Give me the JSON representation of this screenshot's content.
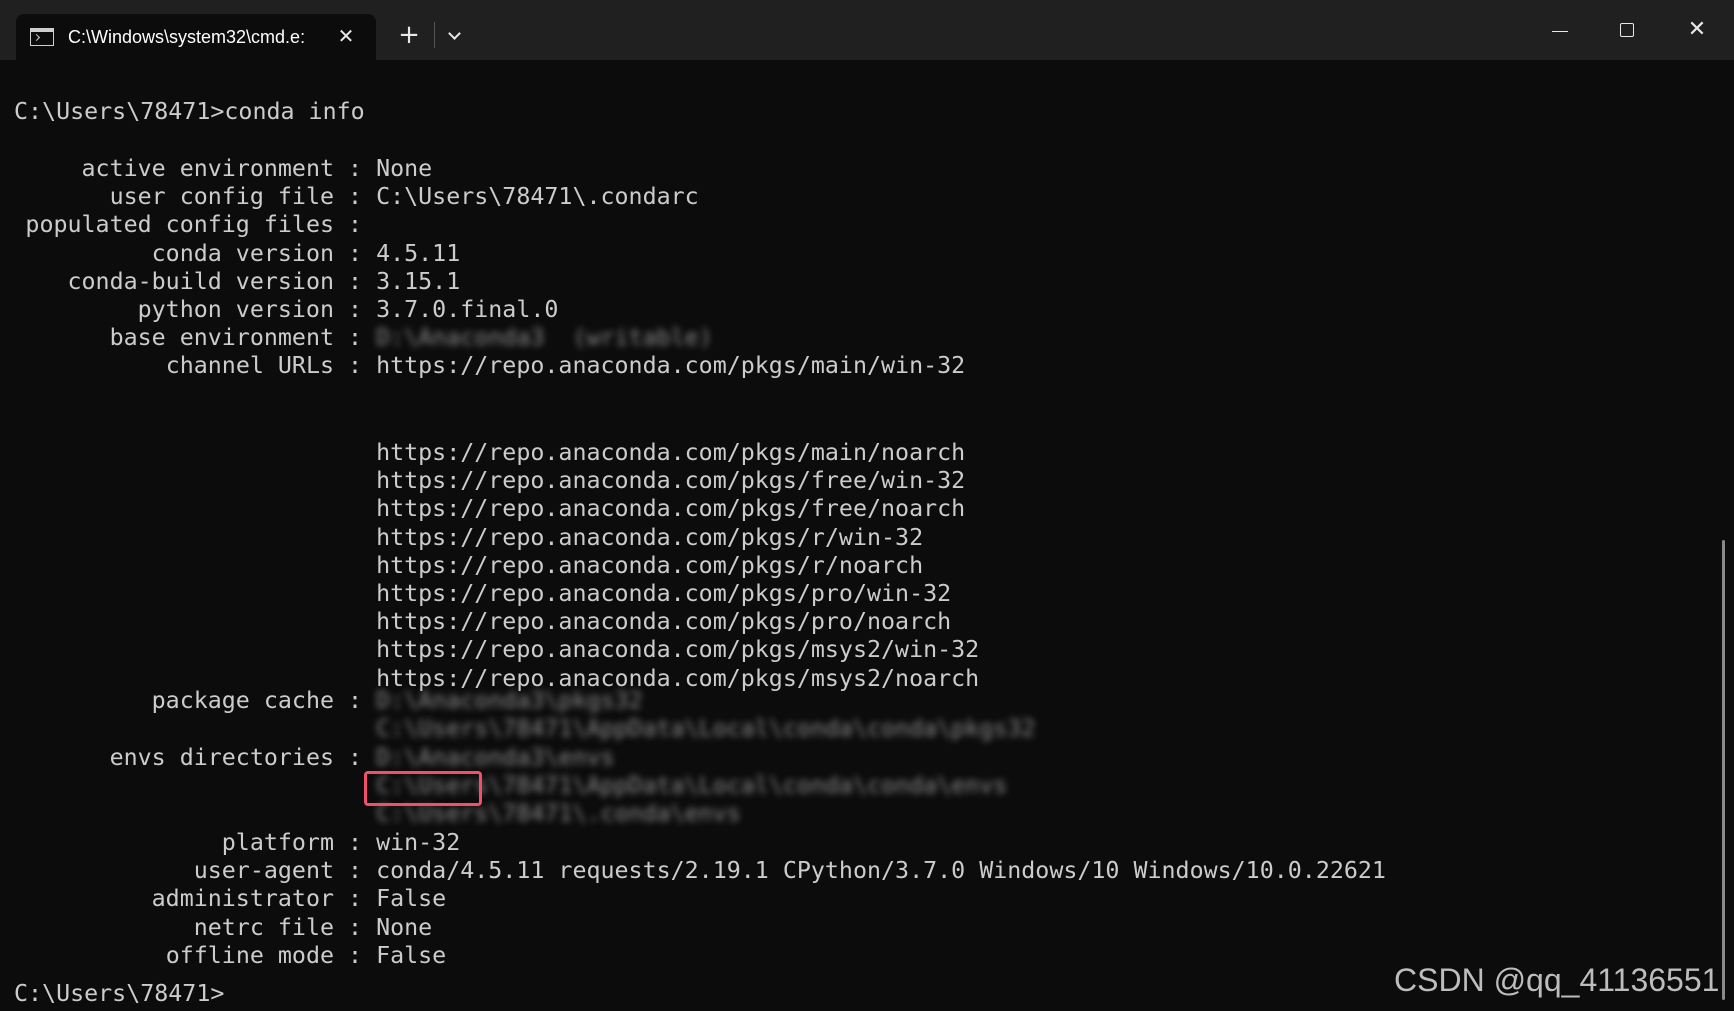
{
  "window": {
    "tab_title": "C:\\Windows\\system32\\cmd.e:",
    "tab_close": "✕",
    "new_tab": "+",
    "close_glyph": "✕"
  },
  "icons": {
    "tab": "terminal-icon",
    "close_tab": "close-icon",
    "new_tab": "plus-icon",
    "dropdown": "chevron-down-icon",
    "minimize": "minimize-icon",
    "maximize": "maximize-icon",
    "close": "close-icon"
  },
  "colors": {
    "terminal_background": "#0c0c0c",
    "titlebar_background": "#202020",
    "terminal_text": "#cccccc",
    "highlight_box": "#f0506e"
  },
  "terminal": {
    "command_prompt": "C:\\Users\\78471>conda info",
    "info": [
      {
        "label": "active environment",
        "value": "None"
      },
      {
        "label": "user config file",
        "value": "C:\\Users\\78471\\.condarc"
      },
      {
        "label": "populated config files",
        "value": ""
      },
      {
        "label": "conda version",
        "value": "4.5.11"
      },
      {
        "label": "conda-build version",
        "value": "3.15.1"
      },
      {
        "label": "python version",
        "value": "3.7.0.final.0"
      },
      {
        "label": "base environment",
        "value": "D:\\Anaconda3  (writable)"
      },
      {
        "label": "channel URLs",
        "value": "https://repo.anaconda.com/pkgs/main/win-32"
      }
    ],
    "channel_urls_continued": [
      "https://repo.anaconda.com/pkgs/main/noarch",
      "https://repo.anaconda.com/pkgs/free/win-32",
      "https://repo.anaconda.com/pkgs/free/noarch",
      "https://repo.anaconda.com/pkgs/r/win-32",
      "https://repo.anaconda.com/pkgs/r/noarch",
      "https://repo.anaconda.com/pkgs/pro/win-32",
      "https://repo.anaconda.com/pkgs/pro/noarch",
      "https://repo.anaconda.com/pkgs/msys2/win-32",
      "https://repo.anaconda.com/pkgs/msys2/noarch"
    ],
    "package_cache": {
      "label": "package cache",
      "values": [
        "D:\\Anaconda3\\pkgs32",
        "C:\\Users\\78471\\AppData\\Local\\conda\\conda\\pkgs32"
      ]
    },
    "envs_directories": {
      "label": "envs directories",
      "values": [
        "D:\\Anaconda3\\envs",
        "C:\\Users\\78471\\AppData\\Local\\conda\\conda\\envs",
        "C:\\Users\\78471\\.conda\\envs"
      ]
    },
    "info_2": [
      {
        "label": "platform",
        "value": "win-32"
      },
      {
        "label": "user-agent",
        "value": "conda/4.5.11 requests/2.19.1 CPython/3.7.0 Windows/10 Windows/10.0.22621"
      },
      {
        "label": "administrator",
        "value": "False"
      },
      {
        "label": "netrc file",
        "value": "None"
      },
      {
        "label": "offline mode",
        "value": "False"
      }
    ],
    "separator": " : ",
    "final_prompt": "C:\\Users\\78471>"
  },
  "watermark": "CSDN @qq_41136551"
}
